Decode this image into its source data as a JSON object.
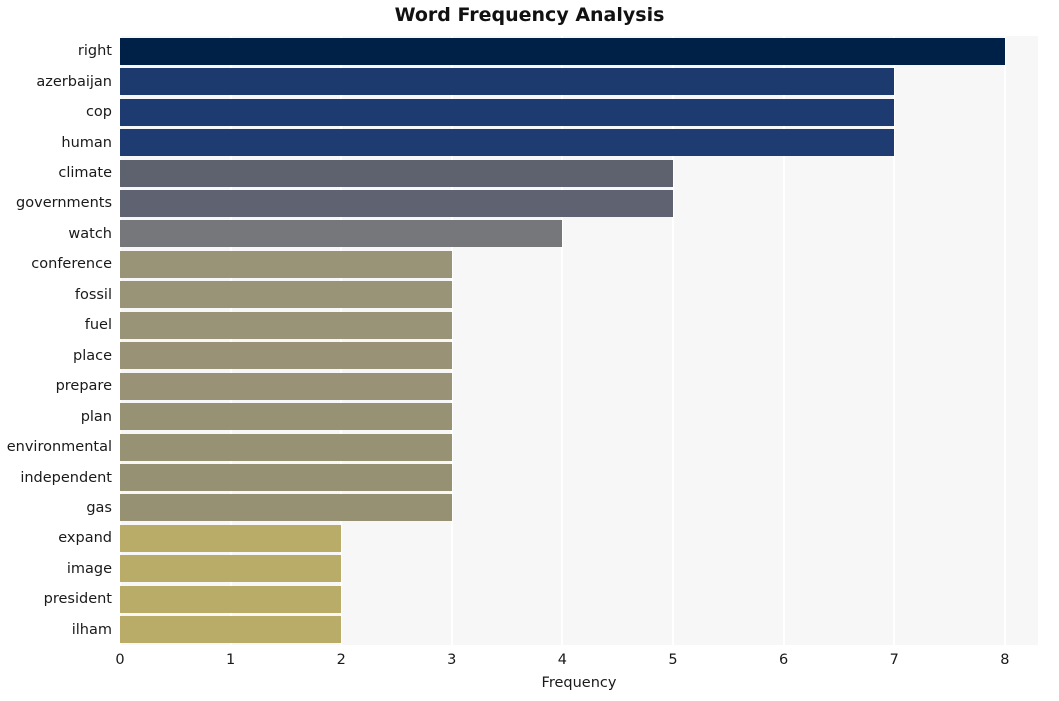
{
  "chart_data": {
    "type": "bar",
    "orientation": "horizontal",
    "title": "Word Frequency Analysis",
    "xlabel": "Frequency",
    "ylabel": "",
    "xlim": [
      0,
      8.3
    ],
    "xticks": [
      0,
      1,
      2,
      3,
      4,
      5,
      6,
      7,
      8
    ],
    "xtick_labels": [
      "0",
      "1",
      "2",
      "3",
      "4",
      "5",
      "6",
      "7",
      "8"
    ],
    "grid": true,
    "grid_axis": "x",
    "grid_color": "#ffffff",
    "plot_background": "#f7f7f7",
    "figure_background": "#ffffff",
    "legend": null,
    "categories": [
      "right",
      "azerbaijan",
      "cop",
      "human",
      "climate",
      "governments",
      "watch",
      "conference",
      "fossil",
      "fuel",
      "place",
      "prepare",
      "plan",
      "environmental",
      "independent",
      "gas",
      "expand",
      "image",
      "president",
      "ilham"
    ],
    "values": [
      8,
      7,
      7,
      7,
      5,
      5,
      4,
      3,
      3,
      3,
      3,
      3,
      3,
      3,
      3,
      3,
      2,
      2,
      2,
      2
    ],
    "bar_colors": [
      "#002147",
      "#1c3a6e",
      "#1d3b70",
      "#1e3c71",
      "#5e616e",
      "#5f6270",
      "#76777a",
      "#999377",
      "#999377",
      "#999377",
      "#999276",
      "#999276",
      "#989275",
      "#989275",
      "#979174",
      "#979174",
      "#b9ac69",
      "#b9ac69",
      "#b9ac69",
      "#b9ac69"
    ]
  }
}
